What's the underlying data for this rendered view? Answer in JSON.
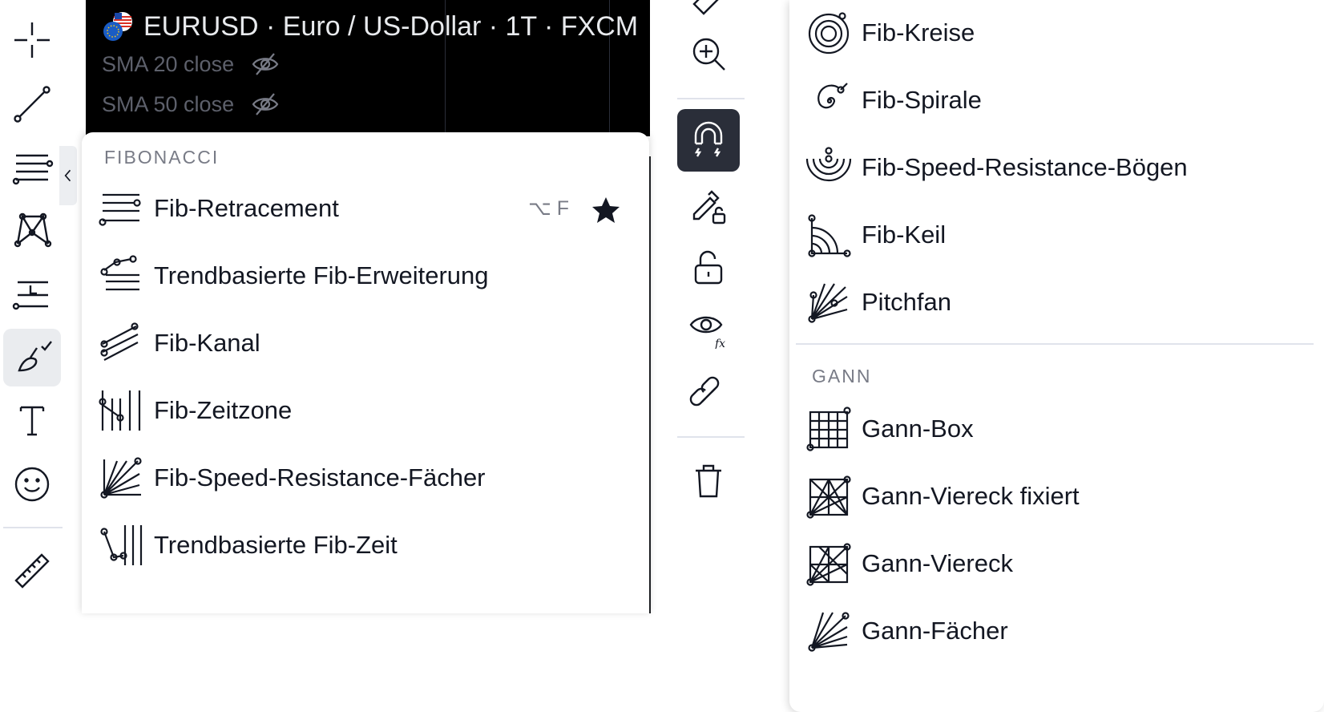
{
  "chart": {
    "symbol_title": "EURUSD · Euro / US-Dollar · 1T · FXCM",
    "studies": [
      "SMA 20 close",
      "SMA 50 close"
    ]
  },
  "fibonacci": {
    "section_title": "FIBONACCI",
    "items": [
      {
        "label": "Fib-Retracement",
        "icon": "fib-retracement-icon"
      },
      {
        "label": "Trendbasierte Fib-Erweiterung",
        "icon": "trend-fib-extension-icon"
      },
      {
        "label": "Fib-Kanal",
        "icon": "fib-channel-icon"
      },
      {
        "label": "Fib-Zeitzone",
        "icon": "fib-timezone-icon"
      },
      {
        "label": "Fib-Speed-Resistance-Fächer",
        "icon": "fib-speed-fan-icon"
      },
      {
        "label": "Trendbasierte Fib-Zeit",
        "icon": "trend-fib-time-icon"
      }
    ],
    "shortcut": "⌥ F"
  },
  "right_panel": {
    "fib_items": [
      {
        "label": "Fib-Kreise",
        "icon": "fib-circles-icon"
      },
      {
        "label": "Fib-Spirale",
        "icon": "fib-spiral-icon"
      },
      {
        "label": "Fib-Speed-Resistance-Bögen",
        "icon": "fib-speed-arcs-icon"
      },
      {
        "label": "Fib-Keil",
        "icon": "fib-wedge-icon"
      },
      {
        "label": "Pitchfan",
        "icon": "pitchfan-icon"
      }
    ],
    "gann_title": "GANN",
    "gann_items": [
      {
        "label": "Gann-Box",
        "icon": "gann-box-icon"
      },
      {
        "label": "Gann-Viereck fixiert",
        "icon": "gann-square-fixed-icon"
      },
      {
        "label": "Gann-Viereck",
        "icon": "gann-square-icon"
      },
      {
        "label": "Gann-Fächer",
        "icon": "gann-fan-icon"
      }
    ]
  },
  "colors": {
    "chart_background": "#000000",
    "active_tool": "#eaecef",
    "magnet_active": "#2a2e39",
    "muted_text": "#787b86"
  }
}
